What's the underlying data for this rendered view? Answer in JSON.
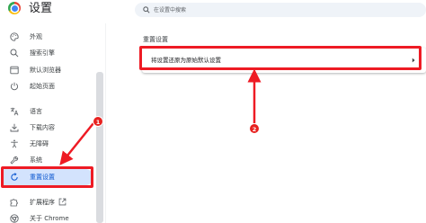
{
  "app": {
    "title": "设置"
  },
  "search": {
    "placeholder": "在设置中搜索"
  },
  "sidebar": {
    "items": [
      {
        "label": "外观",
        "icon": "palette-icon"
      },
      {
        "label": "搜索引擎",
        "icon": "search-icon"
      },
      {
        "label": "默认浏览器",
        "icon": "browser-window-icon"
      },
      {
        "label": "起始页面",
        "icon": "power-icon"
      },
      {
        "label": "语言",
        "icon": "translate-icon"
      },
      {
        "label": "下载内容",
        "icon": "download-icon"
      },
      {
        "label": "无障碍",
        "icon": "accessibility-icon"
      },
      {
        "label": "系统",
        "icon": "wrench-icon"
      },
      {
        "label": "重置设置",
        "icon": "reset-icon",
        "active": true
      },
      {
        "label": "扩展程序",
        "icon": "puzzle-icon"
      },
      {
        "label": "关于 Chrome",
        "icon": "chrome-icon"
      }
    ]
  },
  "main": {
    "section_title": "重置设置",
    "reset_row_label": "将设置还原为原始默认设置"
  },
  "annotations": {
    "badge_1": "1",
    "badge_2": "2",
    "color": "#ee1b24"
  },
  "colors": {
    "active_bg": "#d3e3fd",
    "active_text": "#0b57d0",
    "highlight": "#ee1b24"
  }
}
